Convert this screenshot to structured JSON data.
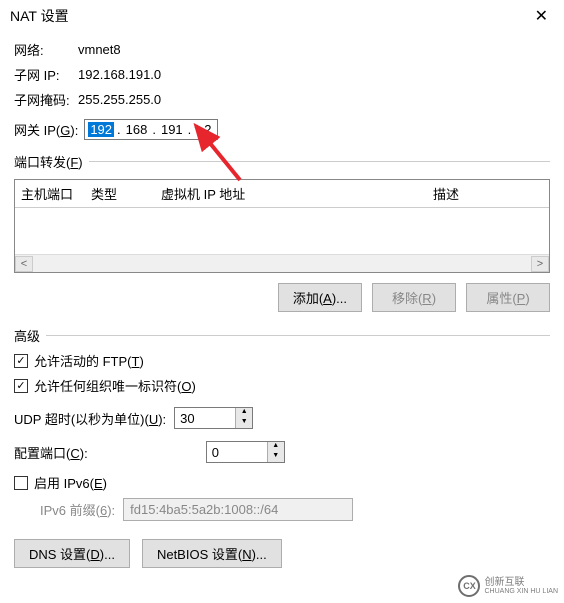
{
  "title": "NAT 设置",
  "network": {
    "label": "网络:",
    "value": "vmnet8"
  },
  "subnet_ip": {
    "label": "子网 IP:",
    "value": "192.168.191.0"
  },
  "subnet_mask": {
    "label": "子网掩码:",
    "value": "255.255.255.0"
  },
  "gateway": {
    "label": "网关 IP(",
    "shortcut": "G",
    "label_end": "):",
    "seg1": "192",
    "seg2": "168",
    "seg3": "191",
    "seg4": "2"
  },
  "port_forward": {
    "legend": "端口转发(",
    "shortcut": "F",
    "legend_end": ")",
    "col_host_port": "主机端口",
    "col_type": "类型",
    "col_vm_ip": "虚拟机 IP 地址",
    "col_desc": "描述"
  },
  "buttons": {
    "add": "添加(",
    "add_k": "A",
    "add_end": ")...",
    "remove": "移除(",
    "remove_k": "R",
    "remove_end": ")",
    "props": "属性(",
    "props_k": "P",
    "props_end": ")"
  },
  "advanced": {
    "legend": "高级",
    "active_ftp": "允许活动的 FTP(",
    "active_ftp_k": "T",
    "active_ftp_end": ")",
    "org_id": "允许任何组织唯一标识符(",
    "org_id_k": "O",
    "org_id_end": ")",
    "udp_timeout": "UDP 超时(以秒为单位)(",
    "udp_timeout_k": "U",
    "udp_timeout_end": "):",
    "udp_value": "30",
    "cfg_port": "配置端口(",
    "cfg_port_k": "C",
    "cfg_port_end": "):",
    "cfg_port_value": "0",
    "ipv6": "启用 IPv6(",
    "ipv6_k": "E",
    "ipv6_end": ")",
    "ipv6_prefix_label": "IPv6 前缀(",
    "ipv6_prefix_k": "6",
    "ipv6_prefix_end": "):",
    "ipv6_prefix_value": "fd15:4ba5:5a2b:1008::/64"
  },
  "bottom": {
    "dns": "DNS 设置(",
    "dns_k": "D",
    "dns_end": ")...",
    "netbios": "NetBIOS 设置(",
    "netbios_k": "N",
    "netbios_end": ")..."
  },
  "watermark": {
    "brand": "创新互联",
    "sub": "CHUANG XIN HU LIAN"
  }
}
